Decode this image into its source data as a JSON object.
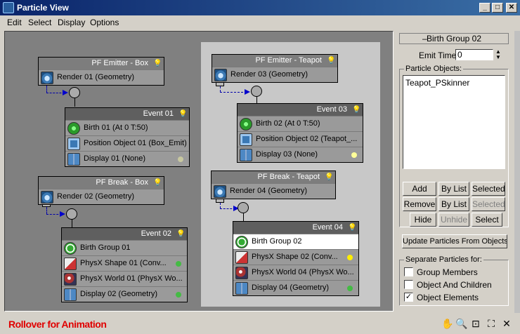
{
  "window": {
    "title": "Particle View"
  },
  "menu": [
    "Edit",
    "Select",
    "Display",
    "Options"
  ],
  "nodes": {
    "emitter_box": {
      "title": "PF Emitter - Box",
      "ops": [
        {
          "label": "Render 01 (Geometry)",
          "icon": "render-icon"
        }
      ]
    },
    "event01": {
      "title": "Event 01",
      "ops": [
        {
          "label": "Birth 01 (At 0 T:50)",
          "icon": "birth-icon"
        },
        {
          "label": "Position Object 01 (Box_Emit)",
          "icon": "position-icon"
        },
        {
          "label": "Display 01 (None)",
          "icon": "display-icon",
          "dot": "#c8c8a0"
        }
      ]
    },
    "break_box": {
      "title": "PF Break - Box",
      "ops": [
        {
          "label": "Render 02 (Geometry)",
          "icon": "render-icon"
        }
      ]
    },
    "event02": {
      "title": "Event 02",
      "ops": [
        {
          "label": "Birth Group 01",
          "icon": "birth-group-icon"
        },
        {
          "label": "PhysX Shape 01 (Conv...",
          "icon": "physx-shape-icon",
          "dot": "#44bb44"
        },
        {
          "label": "PhysX World 01 (PhysX Wo...",
          "icon": "physx-world-icon"
        },
        {
          "label": "Display 02 (Geometry)",
          "icon": "display-icon",
          "dot": "#44bb44"
        }
      ]
    },
    "emitter_teapot": {
      "title": "PF Emitter - Teapot",
      "ops": [
        {
          "label": "Render 03 (Geometry)",
          "icon": "render-icon"
        }
      ]
    },
    "event03": {
      "title": "Event 03",
      "ops": [
        {
          "label": "Birth 02 (At 0 T:50)",
          "icon": "birth-icon"
        },
        {
          "label": "Position Object 02 (Teapot_...",
          "icon": "position-icon"
        },
        {
          "label": "Display 03 (None)",
          "icon": "display-icon",
          "dot": "#ffff99"
        }
      ]
    },
    "break_teapot": {
      "title": "PF Break - Teapot",
      "ops": [
        {
          "label": "Render 04 (Geometry)",
          "icon": "render-icon"
        }
      ]
    },
    "event04": {
      "title": "Event 04",
      "ops": [
        {
          "label": "Birth Group 02",
          "icon": "birth-group-icon"
        },
        {
          "label": "PhysX Shape 02 (Conv...",
          "icon": "physx-shape-icon",
          "dot": "#ffee00"
        },
        {
          "label": "PhysX World 04 (PhysX Wo...",
          "icon": "physx-world-icon"
        },
        {
          "label": "Display 04 (Geometry)",
          "icon": "display-icon",
          "dot": "#44bb44"
        }
      ]
    }
  },
  "panel": {
    "rollout_title": "Birth Group 02",
    "emit_time_label": "Emit Time:",
    "emit_time_value": "0",
    "particle_objects_label": "Particle Objects:",
    "particle_objects": [
      "Teapot_PSkinner"
    ],
    "buttons": {
      "add": "Add",
      "by_list_1": "By List",
      "selected_1": "Selected",
      "remove": "Remove",
      "by_list_2": "By List",
      "selected_2": "Selected",
      "hide": "Hide",
      "unhide": "Unhide",
      "select": "Select"
    },
    "update_button": "Update Particles From Objects",
    "separate_label": "Separate Particles for:",
    "separate_options": [
      {
        "label": "Group Members",
        "checked": false
      },
      {
        "label": "Object And Children",
        "checked": false
      },
      {
        "label": "Object Elements",
        "checked": true
      }
    ]
  },
  "status": {
    "text": "Rollover for Animation"
  }
}
